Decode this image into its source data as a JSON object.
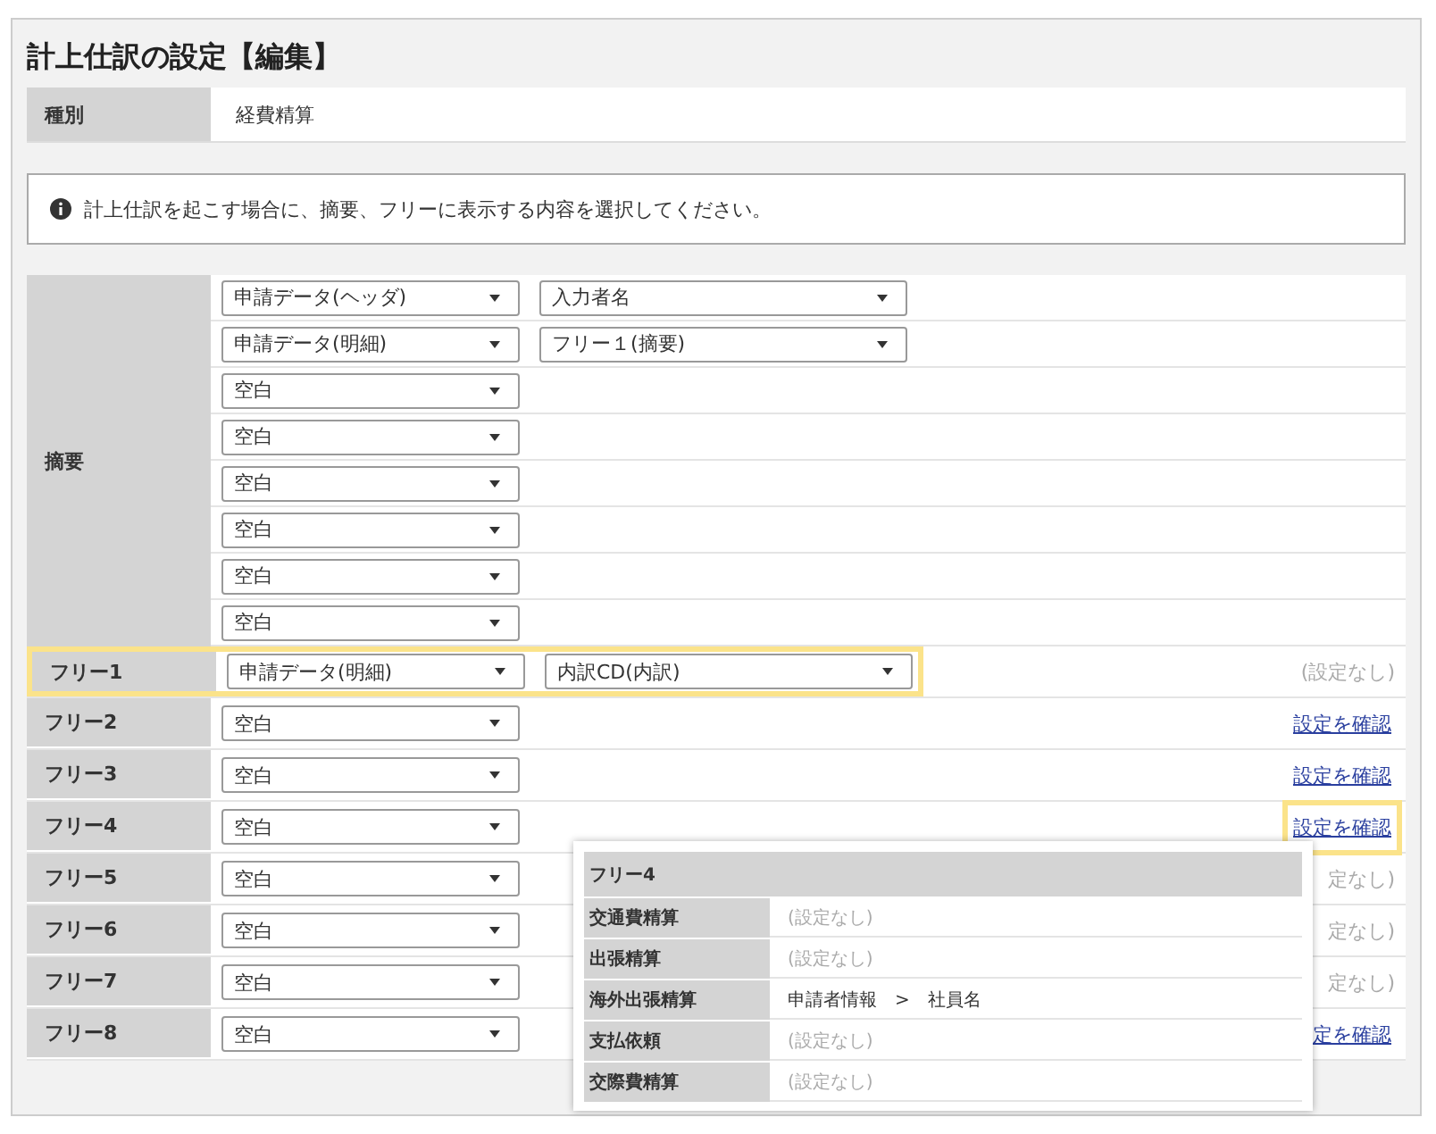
{
  "title": "計上仕訳の設定【編集】",
  "type_row": {
    "label": "種別",
    "value": "経費精算"
  },
  "info": "計上仕訳を起こす場合に、摘要、フリーに表示する内容を選択してください。",
  "summary": {
    "label": "摘要",
    "rows": [
      {
        "selects": [
          "申請データ(ヘッダ)",
          "入力者名"
        ]
      },
      {
        "selects": [
          "申請データ(明細)",
          "フリー１(摘要)"
        ]
      },
      {
        "selects": [
          "空白"
        ]
      },
      {
        "selects": [
          "空白"
        ]
      },
      {
        "selects": [
          "空白"
        ]
      },
      {
        "selects": [
          "空白"
        ]
      },
      {
        "selects": [
          "空白"
        ]
      },
      {
        "selects": [
          "空白"
        ]
      }
    ]
  },
  "free_rows": [
    {
      "label": "フリー1",
      "selects": [
        "申請データ(明細)",
        "内訳CD(内訳)"
      ],
      "highlighted": true,
      "action": {
        "kind": "none",
        "text": "(設定なし)",
        "highlighted": false
      }
    },
    {
      "label": "フリー2",
      "selects": [
        "空白"
      ],
      "highlighted": false,
      "action": {
        "kind": "link",
        "text": "設定を確認",
        "highlighted": false
      }
    },
    {
      "label": "フリー3",
      "selects": [
        "空白"
      ],
      "highlighted": false,
      "action": {
        "kind": "link",
        "text": "設定を確認",
        "highlighted": false
      }
    },
    {
      "label": "フリー4",
      "selects": [
        "空白"
      ],
      "highlighted": false,
      "action": {
        "kind": "link",
        "text": "設定を確認",
        "highlighted": true
      }
    },
    {
      "label": "フリー5",
      "selects": [
        "空白"
      ],
      "highlighted": false,
      "action": {
        "kind": "none",
        "text": "定なし)",
        "highlighted": false
      }
    },
    {
      "label": "フリー6",
      "selects": [
        "空白"
      ],
      "highlighted": false,
      "action": {
        "kind": "none",
        "text": "定なし)",
        "highlighted": false
      }
    },
    {
      "label": "フリー7",
      "selects": [
        "空白"
      ],
      "highlighted": false,
      "action": {
        "kind": "none",
        "text": "定なし)",
        "highlighted": false
      }
    },
    {
      "label": "フリー8",
      "selects": [
        "空白"
      ],
      "highlighted": false,
      "action": {
        "kind": "link",
        "text": "定を確認",
        "highlighted": false
      }
    }
  ],
  "popup": {
    "title": "フリー4",
    "rows": [
      {
        "label": "交通費精算",
        "value": "(設定なし)",
        "kind": "none"
      },
      {
        "label": "出張精算",
        "value": "(設定なし)",
        "kind": "none"
      },
      {
        "label": "海外出張精算",
        "value": "申請者情報　>　社員名",
        "kind": "value"
      },
      {
        "label": "支払依頼",
        "value": "(設定なし)",
        "kind": "none"
      },
      {
        "label": "交際費精算",
        "value": "(設定なし)",
        "kind": "none"
      }
    ]
  }
}
